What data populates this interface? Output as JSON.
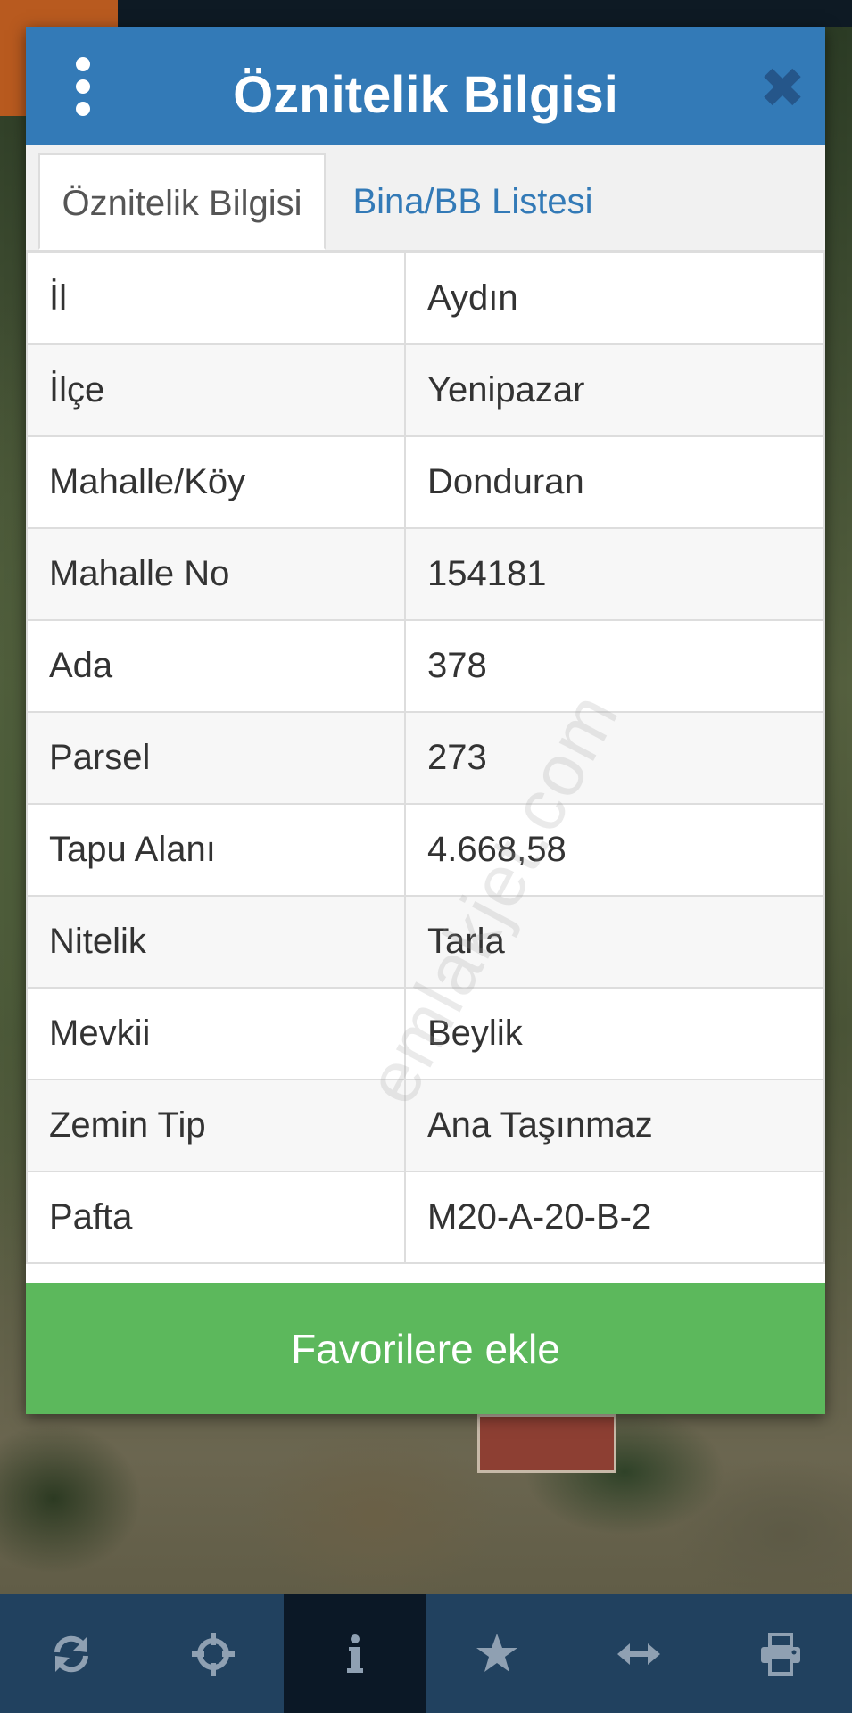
{
  "dialog": {
    "title": "Öznitelik Bilgisi",
    "close_icon": "close-icon",
    "menu_icon": "vertical-dots-icon"
  },
  "tabs": [
    {
      "label": "Öznitelik Bilgisi",
      "active": true
    },
    {
      "label": "Bina/BB Listesi",
      "active": false
    }
  ],
  "attributes": [
    {
      "key": "İl",
      "value": "Aydın"
    },
    {
      "key": "İlçe",
      "value": "Yenipazar"
    },
    {
      "key": "Mahalle/Köy",
      "value": "Donduran"
    },
    {
      "key": "Mahalle No",
      "value": "154181"
    },
    {
      "key": "Ada",
      "value": "378"
    },
    {
      "key": "Parsel",
      "value": "273"
    },
    {
      "key": "Tapu Alanı",
      "value": "4.668,58"
    },
    {
      "key": "Nitelik",
      "value": "Tarla"
    },
    {
      "key": "Mevkii",
      "value": "Beylik"
    },
    {
      "key": "Zemin Tip",
      "value": "Ana Taşınmaz"
    },
    {
      "key": "Pafta",
      "value": "M20-A-20-B-2"
    }
  ],
  "watermark": "emlakjet.com",
  "favorite_button": "Favorilere ekle",
  "toolbar": [
    {
      "icon": "refresh-icon"
    },
    {
      "icon": "crosshair-icon"
    },
    {
      "icon": "info-icon",
      "active": true
    },
    {
      "icon": "star-icon"
    },
    {
      "icon": "measure-arrows-icon"
    },
    {
      "icon": "print-icon"
    }
  ],
  "colors": {
    "header": "#337ab7",
    "tab_link": "#337ab7",
    "favorite_button": "#5cb85c",
    "toolbar": "#21415f",
    "toolbar_active": "#0b1826"
  }
}
